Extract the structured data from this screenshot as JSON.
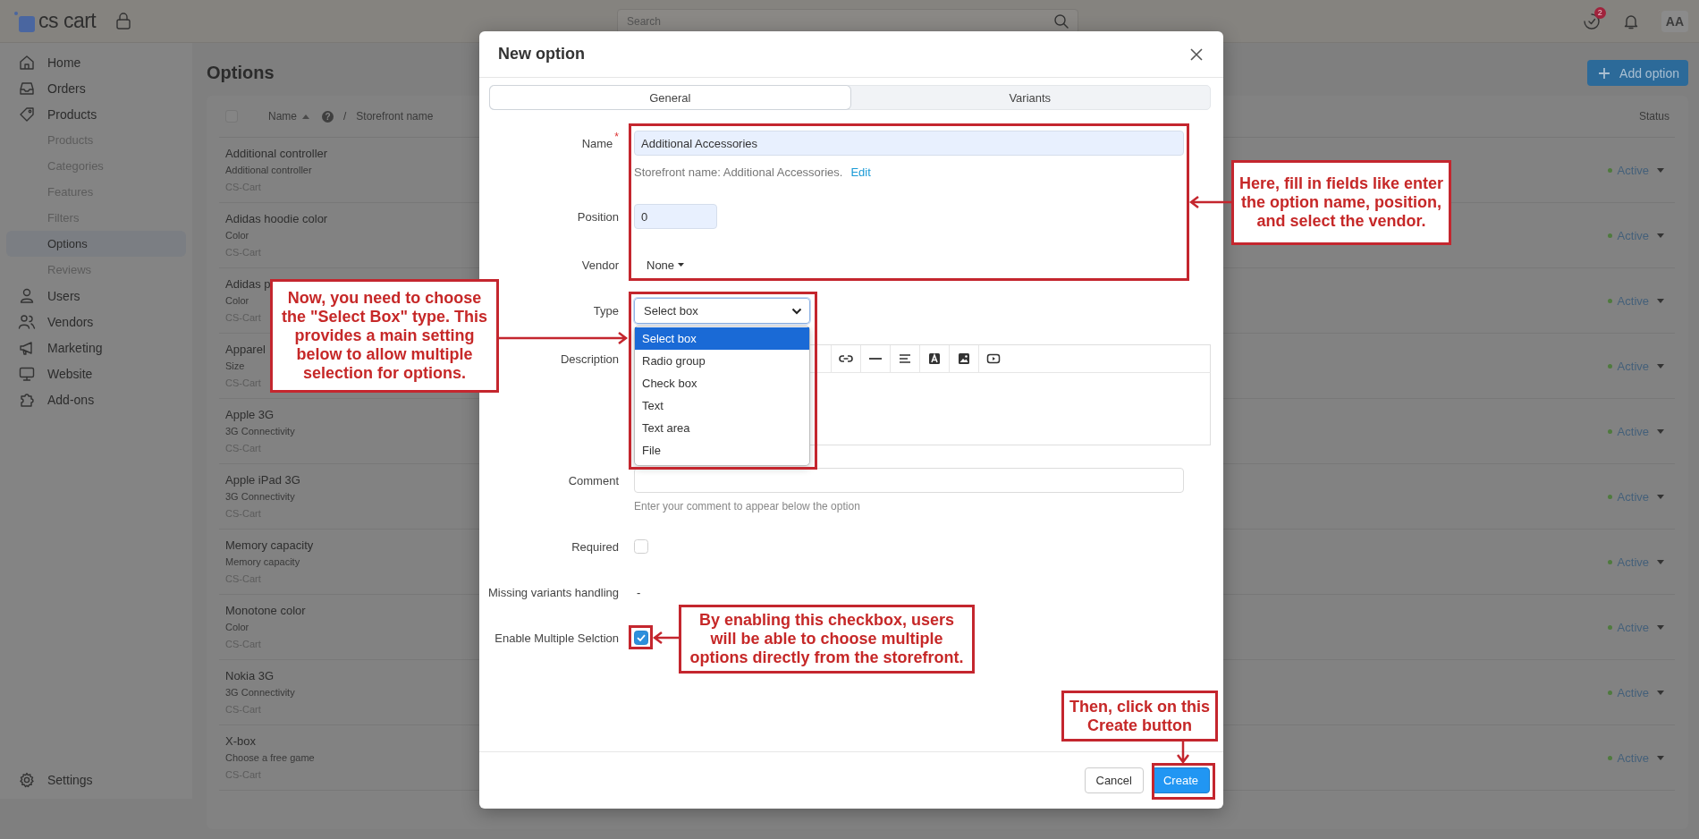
{
  "topbar": {
    "logo": "cs cart",
    "search": {
      "placeholder": "Search"
    },
    "notification_count": "2",
    "avatar": "AA"
  },
  "sidebar": {
    "items": [
      {
        "label": "Home"
      },
      {
        "label": "Orders"
      },
      {
        "label": "Products",
        "children": [
          {
            "label": "Products",
            "selected": false
          },
          {
            "label": "Categories",
            "selected": false
          },
          {
            "label": "Features",
            "selected": false
          },
          {
            "label": "Filters",
            "selected": false
          },
          {
            "label": "Options",
            "selected": true
          },
          {
            "label": "Reviews",
            "selected": false
          }
        ]
      },
      {
        "label": "Users"
      },
      {
        "label": "Vendors"
      },
      {
        "label": "Marketing"
      },
      {
        "label": "Website"
      },
      {
        "label": "Add-ons"
      }
    ],
    "footer_item": {
      "label": "Settings"
    }
  },
  "page": {
    "title": "Options",
    "add_button": "Add option",
    "table": {
      "select_all_checked": false,
      "help_mark": "?",
      "separator": "/",
      "columns": [
        {
          "label": "Name"
        },
        {
          "label": "Storefront name"
        },
        {
          "label": "Status"
        }
      ],
      "rows": [
        {
          "name": "Additional controller",
          "storefront_name": "Additional controller",
          "vendor": "CS-Cart",
          "status": "Active"
        },
        {
          "name": "Adidas hoodie color",
          "storefront_name": "Color",
          "vendor": "CS-Cart",
          "status": "Active"
        },
        {
          "name": "Adidas p",
          "storefront_name": "Color",
          "vendor": "CS-Cart",
          "status": "Active"
        },
        {
          "name": "Apparel",
          "storefront_name": "Size",
          "vendor": "CS-Cart",
          "status": "Active"
        },
        {
          "name": "Apple 3G",
          "storefront_name": "3G Connectivity",
          "vendor": "CS-Cart",
          "status": "Active"
        },
        {
          "name": "Apple iPad 3G",
          "storefront_name": "3G Connectivity",
          "vendor": "CS-Cart",
          "status": "Active"
        },
        {
          "name": "Memory capacity",
          "storefront_name": "Memory capacity",
          "vendor": "CS-Cart",
          "status": "Active"
        },
        {
          "name": "Monotone color",
          "storefront_name": "Color",
          "vendor": "CS-Cart",
          "status": "Active"
        },
        {
          "name": "Nokia 3G",
          "storefront_name": "3G Connectivity",
          "vendor": "CS-Cart",
          "status": "Active"
        },
        {
          "name": "X-box",
          "storefront_name": "Choose a free game",
          "vendor": "CS-Cart",
          "status": "Active"
        }
      ]
    }
  },
  "modal": {
    "title": "New option",
    "tabs": [
      {
        "label": "General",
        "selected": true
      },
      {
        "label": "Variants",
        "selected": false
      }
    ],
    "form": {
      "name": {
        "label": "Name",
        "required_mark": "*",
        "value": "Additional Accessories",
        "note": "Storefront name: Additional Accessories.",
        "link": "Edit"
      },
      "position": {
        "label": "Position",
        "value": "0"
      },
      "vendor": {
        "label": "Vendor",
        "value": "None"
      },
      "type": {
        "label": "Type",
        "value": "Select box",
        "expanded": true,
        "options": [
          {
            "label": "Select box",
            "selected": true
          },
          {
            "label": "Radio group",
            "selected": false
          },
          {
            "label": "Check box",
            "selected": false
          },
          {
            "label": "Text",
            "selected": false
          },
          {
            "label": "Text area",
            "selected": false
          },
          {
            "label": "File",
            "selected": false
          }
        ]
      },
      "description": {
        "label": "Description"
      },
      "comment": {
        "label": "Comment",
        "hint": "Enter your comment to appear below the option"
      },
      "required": {
        "label": "Required",
        "checked": false
      },
      "missing_variants": {
        "label": "Missing variants handling",
        "value": "-"
      },
      "multiple_selection": {
        "label": "Enable Multiple Selction",
        "checked": true
      }
    },
    "buttons": [
      {
        "label": "Cancel",
        "kind": "secondary"
      },
      {
        "label": "Create",
        "kind": "primary"
      }
    ]
  },
  "annotations": [
    {
      "text": "Here, fill in fields like enter the option name, position, and select the vendor."
    },
    {
      "text": "Now, you need to choose the \"Select Box\" type. This provides a main setting below to allow multiple selection for options."
    },
    {
      "text": "By enabling this checkbox, users will be able to choose multiple options directly from the storefront."
    },
    {
      "text": "Then, click on this Create button"
    }
  ]
}
